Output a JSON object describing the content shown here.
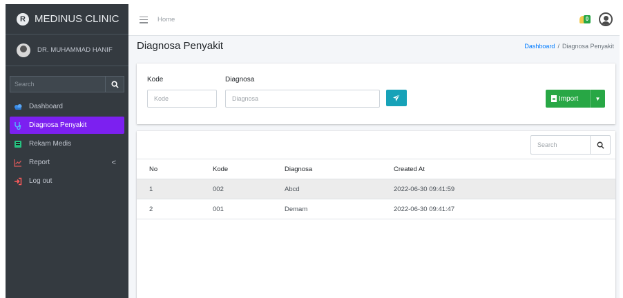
{
  "brand": {
    "name": "MEDINUS CLINIC",
    "logo_letter": "R"
  },
  "user": {
    "name": "DR. MUHAMMAD HANIF"
  },
  "sidebar": {
    "search_placeholder": "Search",
    "items": [
      {
        "label": "Dashboard",
        "icon": "dashboard-icon",
        "active": false
      },
      {
        "label": "Diagnosa Penyakit",
        "icon": "stethoscope-icon",
        "active": true
      },
      {
        "label": "Rekam Medis",
        "icon": "medical-record-icon",
        "active": false
      },
      {
        "label": "Report",
        "icon": "chart-line-icon",
        "active": false,
        "arrow": "<"
      },
      {
        "label": "Log out",
        "icon": "sign-out-icon",
        "active": false
      }
    ]
  },
  "topbar": {
    "home_label": "Home",
    "notification_count": "0"
  },
  "page": {
    "title": "Diagnosa Penyakit"
  },
  "breadcrumb": {
    "link": "Dashboard",
    "separator": "/",
    "current": "Diagnosa Penyakit"
  },
  "form": {
    "kode_label": "Kode",
    "kode_placeholder": "Kode",
    "diagnosa_label": "Diagnosa",
    "diagnosa_placeholder": "Diagnosa",
    "import_label": "Import"
  },
  "table": {
    "search_placeholder": "Search",
    "columns": [
      "No",
      "Kode",
      "Diagnosa",
      "Created At"
    ],
    "rows": [
      [
        "1",
        "002",
        "Abcd",
        "2022-06-30 09:41:59"
      ],
      [
        "2",
        "001",
        "Demam",
        "2022-06-30 09:41:47"
      ]
    ]
  },
  "colors": {
    "sidebar_bg": "#343a40",
    "active_item": "#7c20f0",
    "send_button": "#17a2b8",
    "import_button": "#28a745",
    "link": "#007bff"
  }
}
